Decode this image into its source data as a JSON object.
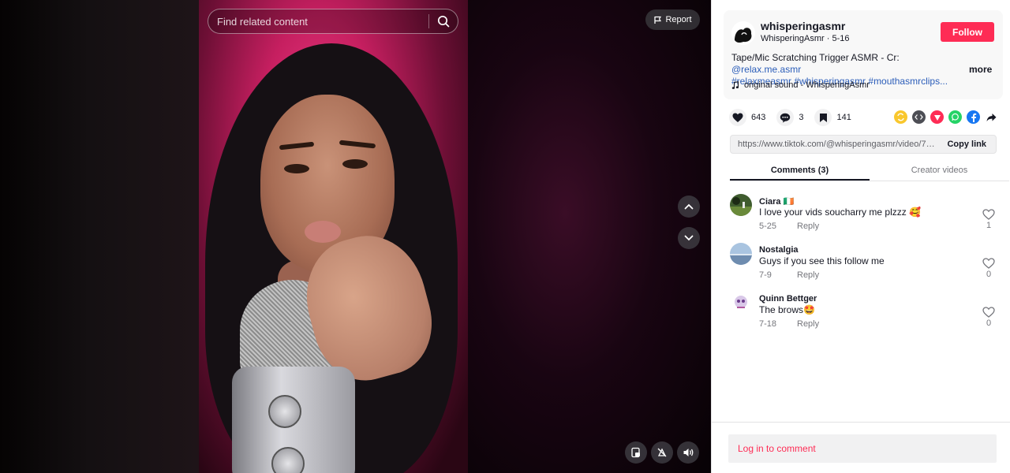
{
  "search": {
    "placeholder": "Find related content"
  },
  "video_controls": {
    "report_label": "Report"
  },
  "author": {
    "username": "whisperingasmr",
    "display_name": "WhisperingAsmr",
    "date": "5-16",
    "follow_label": "Follow"
  },
  "description": {
    "text": "Tape/Mic Scratching Trigger ASMR - Cr: ",
    "mention": "@relax.me.asmr",
    "hashtags": "#relaxmeasmr #whisperingasmr #mouthasmrclips...",
    "more_label": "more"
  },
  "sound": {
    "label": "original sound - WhisperingAsmr"
  },
  "stats": {
    "likes": "643",
    "comments": "3",
    "saves": "141"
  },
  "share": {
    "link": "https://www.tiktok.com/@whisperingasmr/video/73693...",
    "copy_label": "Copy link"
  },
  "tabs": [
    {
      "label": "Comments (3)",
      "active": true
    },
    {
      "label": "Creator videos",
      "active": false
    }
  ],
  "comments": [
    {
      "name": "Ciara 🇮🇪",
      "text": "I love your vids soucharry me plzzz 🥰",
      "date": "5-25",
      "reply_label": "Reply",
      "likes": "1"
    },
    {
      "name": "Nostalgia",
      "text": "Guys if you see this follow me",
      "date": "7-9",
      "reply_label": "Reply",
      "likes": "0"
    },
    {
      "name": "Quinn Bettger",
      "text": "The brows🤩",
      "date": "7-18",
      "reply_label": "Reply",
      "likes": "0"
    }
  ],
  "footer": {
    "login_label": "Log in to comment"
  },
  "colors": {
    "accent": "#fe2c55",
    "link": "#2b5db9",
    "text": "#161823",
    "muted": "#75767c"
  }
}
